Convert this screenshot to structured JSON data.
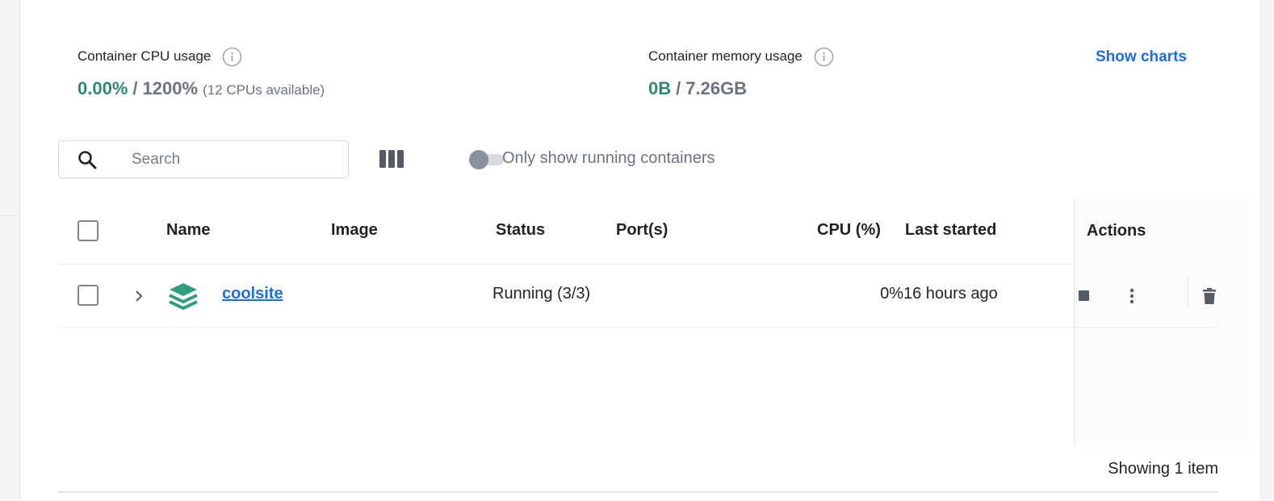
{
  "stats": {
    "cpu": {
      "label": "Container CPU usage",
      "used": "0.00%",
      "separator": "/",
      "total": "1200%",
      "note": "(12 CPUs available)"
    },
    "memory": {
      "label": "Container memory usage",
      "used": "0B",
      "separator": "/",
      "total": "7.26GB"
    },
    "show_charts_label": "Show charts"
  },
  "toolbar": {
    "search_placeholder": "Search",
    "running_only_label": "Only show running containers",
    "running_only_enabled": false
  },
  "table": {
    "columns": {
      "name": "Name",
      "image": "Image",
      "status": "Status",
      "ports": "Port(s)",
      "cpu": "CPU (%)",
      "last_started": "Last started",
      "actions": "Actions"
    },
    "rows": [
      {
        "name": "coolsite",
        "image": "",
        "status": "Running (3/3)",
        "ports": "",
        "cpu": "0%",
        "last_started": "16 hours ago"
      }
    ]
  },
  "footer": {
    "count_text": "Showing 1 item"
  },
  "colors": {
    "accent_blue": "#1d6ee5",
    "usage_green": "#2e8a6d",
    "muted_gray": "#6b7280"
  }
}
